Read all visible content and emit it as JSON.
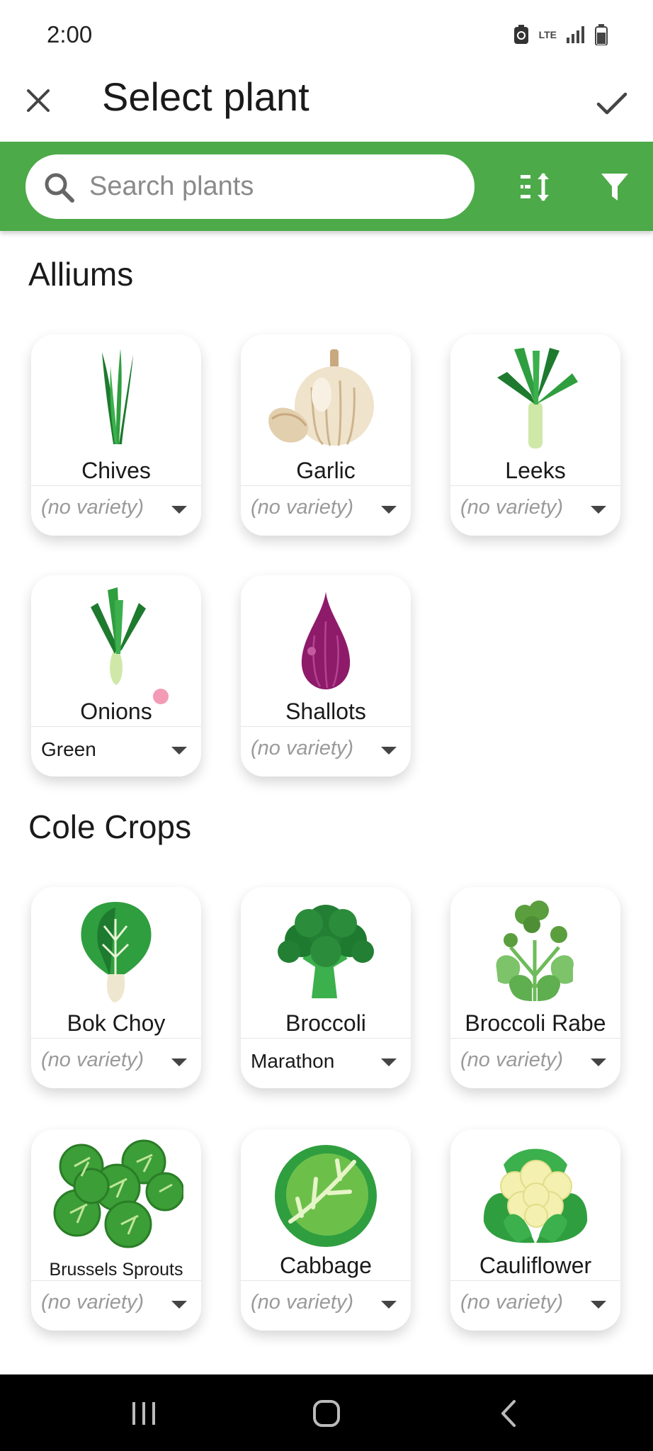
{
  "status": {
    "time": "2:00",
    "network": "LTE"
  },
  "header": {
    "title": "Select plant"
  },
  "search": {
    "placeholder": "Search plants"
  },
  "sections": [
    {
      "title": "Alliums",
      "plants": [
        {
          "name": "Chives",
          "variety": "(no variety)"
        },
        {
          "name": "Garlic",
          "variety": "(no variety)"
        },
        {
          "name": "Leeks",
          "variety": "(no variety)"
        },
        {
          "name": "Onions",
          "variety": "Green"
        },
        {
          "name": "Shallots",
          "variety": "(no variety)"
        }
      ]
    },
    {
      "title": "Cole Crops",
      "plants": [
        {
          "name": "Bok Choy",
          "variety": "(no variety)"
        },
        {
          "name": "Broccoli",
          "variety": "Marathon"
        },
        {
          "name": "Broccoli Rabe",
          "variety": "(no variety)"
        },
        {
          "name": "Brussels Sprouts",
          "variety": "(no variety)"
        },
        {
          "name": "Cabbage",
          "variety": "(no variety)"
        },
        {
          "name": "Cauliflower",
          "variety": "(no variety)"
        }
      ]
    }
  ],
  "colors": {
    "accent": "#4caa48",
    "navbar": "#000000"
  }
}
